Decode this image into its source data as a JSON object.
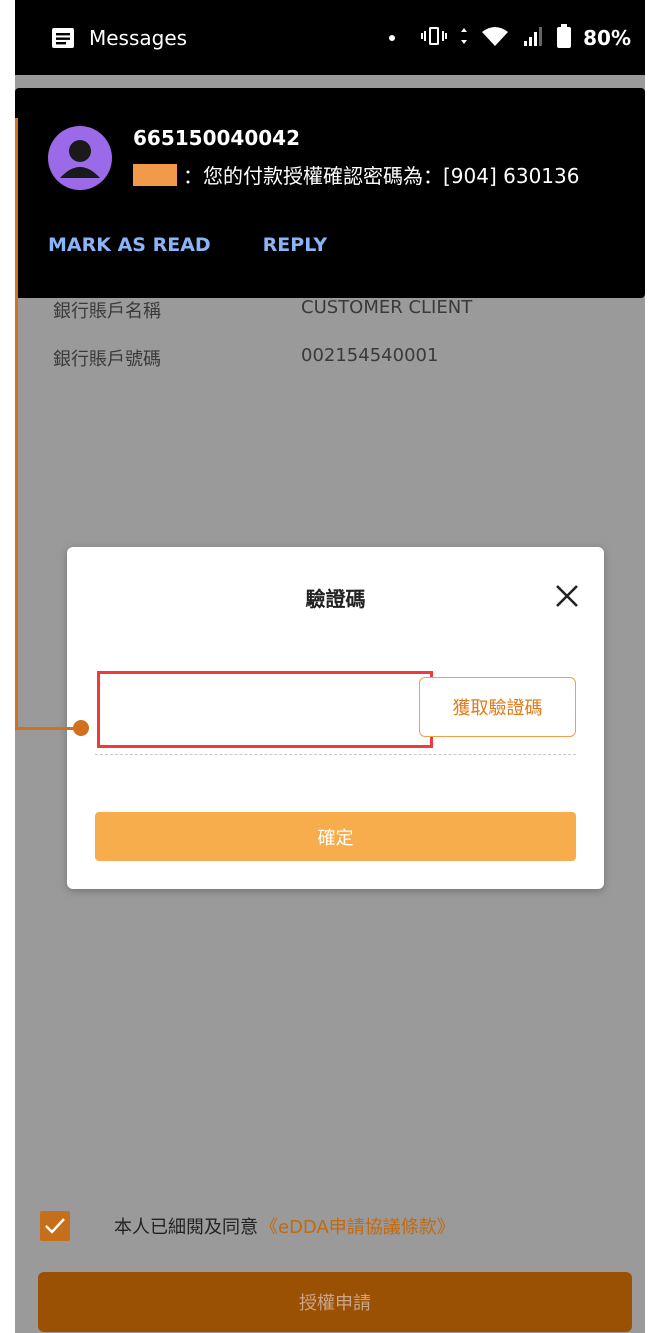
{
  "status_bar": {
    "app_label": "Messages",
    "battery_percent": "80%"
  },
  "notification": {
    "sender": "665150040042",
    "message": "：您的付款授權確認密碼為：[904] 630136",
    "actions": [
      "MARK AS READ",
      "REPLY"
    ]
  },
  "account": {
    "name_label": "銀行賬戶名稱",
    "name_value": "CUSTOMER CLIENT",
    "number_label": "銀行賬戶號碼",
    "number_value": "002154540001"
  },
  "dialog": {
    "title": "驗證碼",
    "code_value": "",
    "get_code_label": "獲取驗證碼",
    "confirm_label": "確定"
  },
  "footer": {
    "agree_text": "本人已細閱及同意",
    "terms_link": "《eDDA申請協議條款》",
    "checked": true,
    "submit_label": "授權申請"
  },
  "colors": {
    "accent_orange": "#f8ad4d",
    "annotation": "#d0711e",
    "link_blue": "#8ab4f8",
    "highlight_red": "#ef3b3b"
  }
}
